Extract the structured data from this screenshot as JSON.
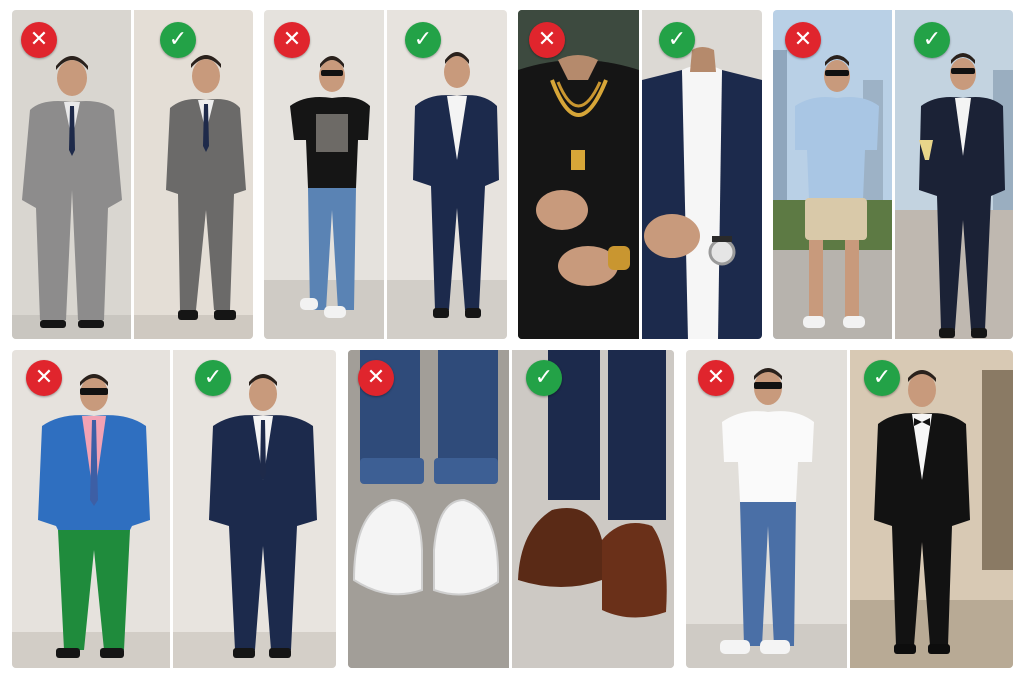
{
  "badges": {
    "bad_icon": "x-mark-icon",
    "good_icon": "checkmark-icon",
    "bad_symbol": "✕",
    "good_symbol": "✓",
    "bad_color": "#e0252d",
    "good_color": "#23a247"
  },
  "comparisons": [
    {
      "topic": "suit-fit",
      "bad": "oversized grey suit",
      "good": "tailored grey suit"
    },
    {
      "topic": "graphic-tee-vs-blazer",
      "bad": "graphic t-shirt with jeans",
      "good": "navy blazer with white shirt"
    },
    {
      "topic": "jewelry",
      "bad": "heavy gold chains and rings",
      "good": "simple watch with shirt and jacket"
    },
    {
      "topic": "event-dress",
      "bad": "short-sleeve shirt and shorts",
      "good": "dark suit with champagne glass"
    },
    {
      "topic": "color-clash",
      "bad": "blue blazer, pink shirt, green trousers",
      "good": "navy suit"
    },
    {
      "topic": "footwear",
      "bad": "white sneakers with cuffed jeans",
      "good": "brown leather oxfords"
    },
    {
      "topic": "formal-event",
      "bad": "white t-shirt and jeans",
      "good": "black tuxedo with bow tie"
    }
  ]
}
